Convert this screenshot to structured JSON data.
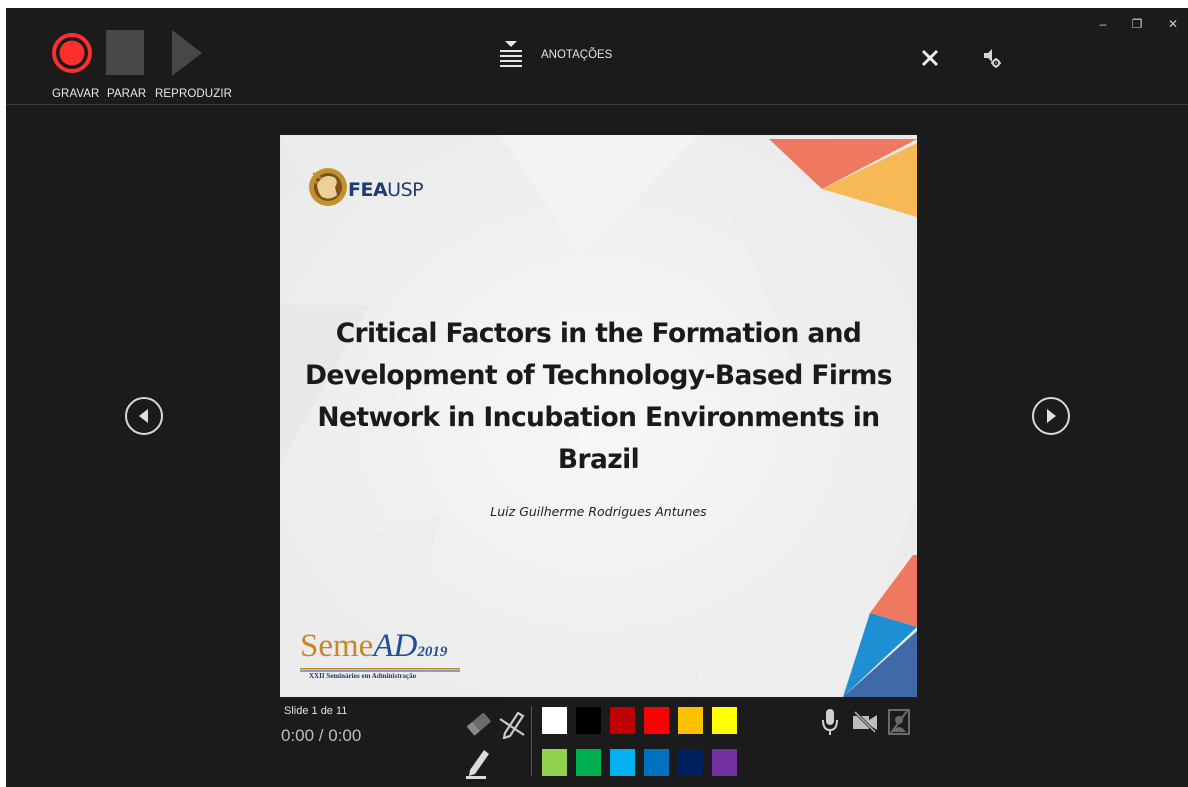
{
  "toolbar": {
    "record_label": "GRAVAR",
    "stop_label": "PARAR",
    "play_label": "REPRODUZIR",
    "annotations_label": "ANOTAÇÕES",
    "icons": {
      "record": "record-icon",
      "stop": "stop-icon",
      "play": "play-icon",
      "annotations": "notes-toggle-icon",
      "close": "close-icon",
      "settings": "audio-settings-icon"
    }
  },
  "window_controls": {
    "minimize": "–",
    "restore": "❐",
    "close": "✕"
  },
  "slide": {
    "logo_text_bold": "FEA",
    "logo_text_regular": "USP",
    "title": "Critical Factors in the Formation and Development of Technology-Based Firms Network in Incubation Environments in Brazil",
    "author": "Luiz Guilherme Rodrigues Antunes",
    "event_logo_seme": "Seme",
    "event_logo_ad": "AD",
    "event_logo_year": "2019",
    "event_subtitle": "XXII Seminários em Administração",
    "colors": {
      "triangle_top_1": "#ef7860",
      "triangle_top_2": "#f7b955",
      "triangle_bottom_1": "#ef7860",
      "triangle_bottom_2": "#1f8fd4",
      "triangle_bottom_3": "#3f6aa8"
    }
  },
  "navigation": {
    "prev": "previous-slide-icon",
    "next": "next-slide-icon"
  },
  "status": {
    "slide_counter": "Slide 1 de 11",
    "time": "0:00 / 0:00"
  },
  "pen_tools": {
    "eraser": "eraser-icon",
    "pen_off": "pen-off-icon",
    "pen": "pen-icon"
  },
  "palette": {
    "row1": [
      "#ffffff",
      "#000000",
      "#c00000",
      "#ff0000",
      "#ffc000",
      "#ffff00"
    ],
    "row2": [
      "#92d050",
      "#00b050",
      "#00b0f0",
      "#0070c0",
      "#002060",
      "#7030a0"
    ]
  },
  "media_toggles": {
    "microphone": "microphone-icon",
    "camera_off": "camera-off-icon",
    "camera_preview_off": "camera-preview-off-icon"
  }
}
